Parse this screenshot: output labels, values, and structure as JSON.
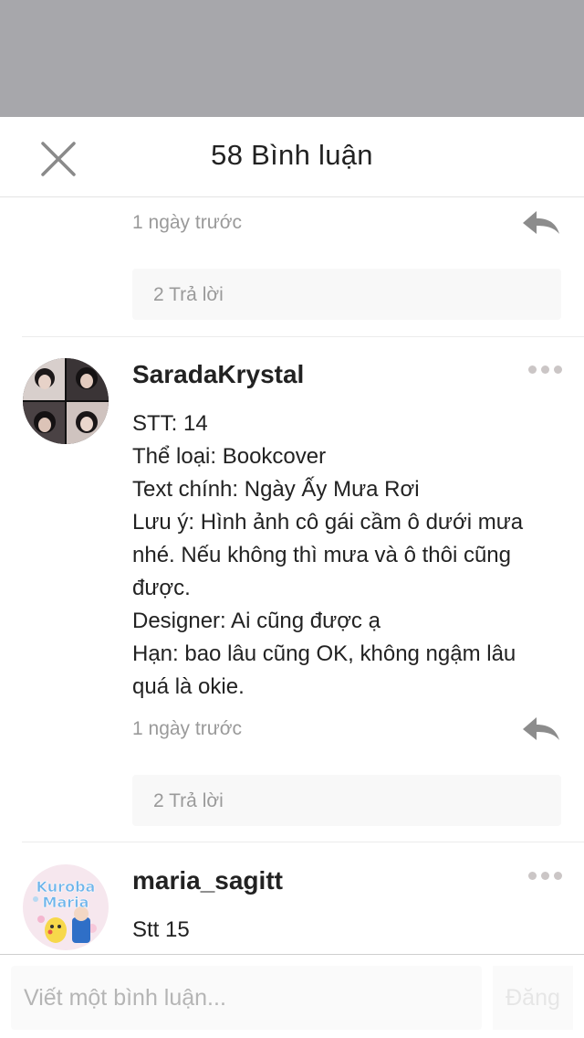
{
  "header": {
    "title": "58 Bình luận",
    "close_icon": "close-icon"
  },
  "comments": [
    {
      "time": "1 ngày trước",
      "replies_label": "2 Trả lời",
      "reply_icon": "reply-arrow-icon"
    },
    {
      "username": "SaradaKrystal",
      "avatar": "user-photo-collage",
      "body_lines": [
        "STT: 14",
        "Thể loại: Bookcover",
        "Text chính: Ngày Ấy Mưa Rơi",
        "Lưu ý: Hình ảnh cô gái cầm ô dưới mưa",
        "nhé. Nếu không thì mưa và ô thôi cũng",
        "được.",
        "Designer: Ai cũng được ạ",
        "Hạn: bao lâu cũng OK, không ngậm lâu",
        "quá là okie."
      ],
      "time": "1 ngày trước",
      "replies_label": "2 Trả lời",
      "more_icon": "more-dots-icon",
      "reply_icon": "reply-arrow-icon"
    },
    {
      "username": "maria_sagitt",
      "avatar": "kuroba-maria-badge",
      "avatar_text": [
        "Kuroba",
        "Maria"
      ],
      "body_lines": [
        "Stt 15"
      ],
      "more_icon": "more-dots-icon"
    }
  ],
  "footer": {
    "input_placeholder": "Viết một bình luận...",
    "post_label": "Đăng"
  },
  "colors": {
    "overlay": "#a7a7ab",
    "meta_text": "#9a9a9a",
    "reply_icon": "#8c8c8c",
    "more_dots": "#cbc6c6",
    "post_disabled": "#e6e6e6"
  }
}
